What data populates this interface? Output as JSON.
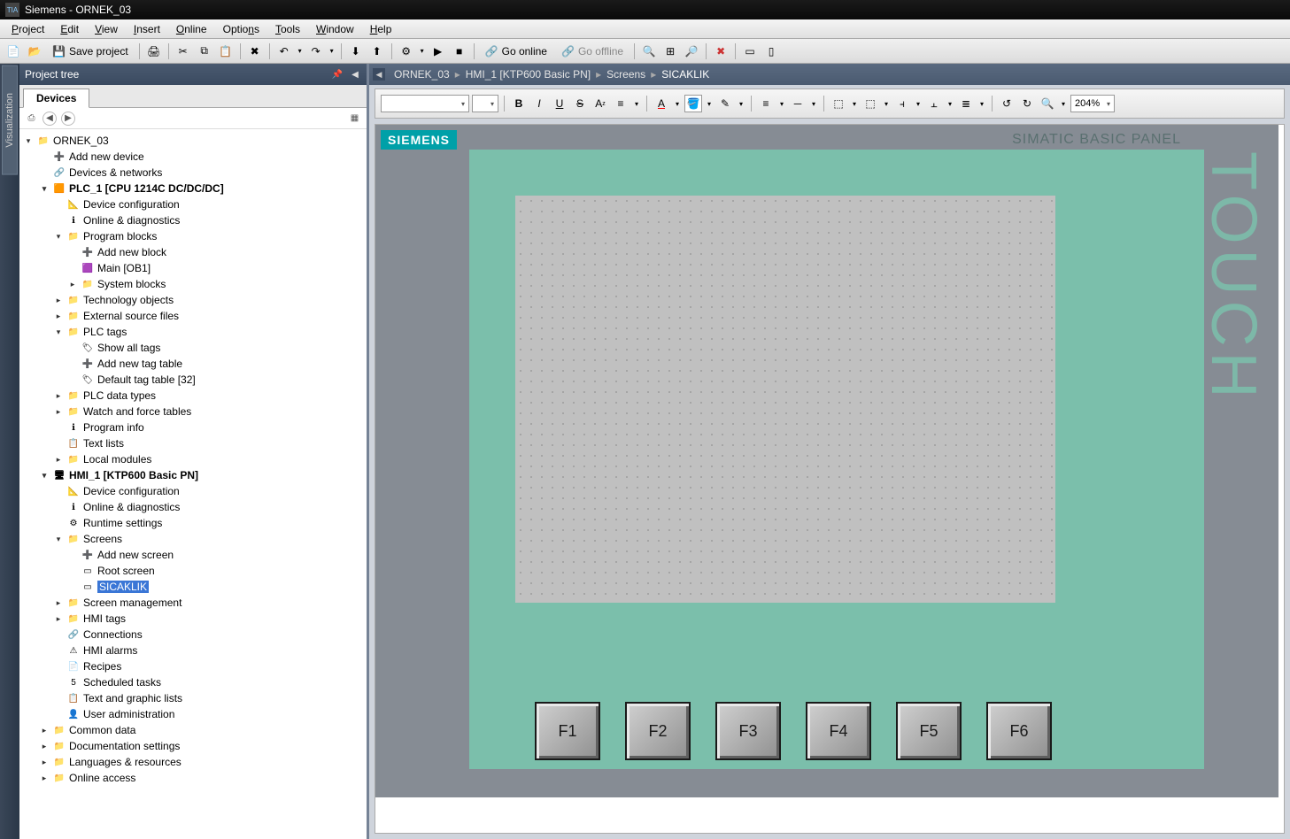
{
  "app": {
    "title": "Siemens  -  ORNEK_03"
  },
  "menu": [
    "Project",
    "Edit",
    "View",
    "Insert",
    "Online",
    "Options",
    "Tools",
    "Window",
    "Help"
  ],
  "toolbar": {
    "save_label": "Save project",
    "go_online": "Go online",
    "go_offline": "Go offline"
  },
  "sidebar_tab": "Visualization",
  "projtree": {
    "title": "Project tree"
  },
  "devices_tab": "Devices",
  "tree": {
    "root": "ORNEK_03",
    "add_device": "Add new device",
    "devices_networks": "Devices & networks",
    "plc": "PLC_1 [CPU 1214C DC/DC/DC]",
    "device_config": "Device configuration",
    "online_diag": "Online & diagnostics",
    "prog_blocks": "Program blocks",
    "add_block": "Add new block",
    "main_ob1": "Main [OB1]",
    "sys_blocks": "System blocks",
    "tech_obj": "Technology objects",
    "ext_src": "External source files",
    "plc_tags": "PLC tags",
    "show_all_tags": "Show all tags",
    "add_tag_table": "Add new tag table",
    "def_tag_table": "Default tag table [32]",
    "plc_data_types": "PLC data types",
    "watch_force": "Watch and force tables",
    "prog_info": "Program info",
    "text_lists": "Text lists",
    "local_modules": "Local modules",
    "hmi": "HMI_1 [KTP600 Basic PN]",
    "hmi_devcfg": "Device configuration",
    "hmi_online": "Online & diagnostics",
    "runtime": "Runtime settings",
    "screens": "Screens",
    "add_screen": "Add new screen",
    "root_screen": "Root screen",
    "sel_screen": "SICAKLIK",
    "screen_mgmt": "Screen management",
    "hmi_tags": "HMI tags",
    "connections": "Connections",
    "hmi_alarms": "HMI alarms",
    "recipes": "Recipes",
    "sched_tasks": "Scheduled tasks",
    "text_graphic": "Text and graphic lists",
    "user_admin": "User administration",
    "common_data": "Common data",
    "doc_settings": "Documentation settings",
    "lang_res": "Languages & resources",
    "online_access": "Online access"
  },
  "breadcrumb": [
    "ORNEK_03",
    "HMI_1 [KTP600 Basic PN]",
    "Screens",
    "SICAKLIK"
  ],
  "editor_toolbar": {
    "font_combo": "",
    "size_combo": "",
    "bold": "B",
    "italic": "I",
    "underline": "U",
    "strike": "S",
    "text_letter": "A",
    "zoom_value": "204%"
  },
  "hmi_panel": {
    "brand": "SIEMENS",
    "title": "SIMATIC BASIC PANEL",
    "side": "TOUCH",
    "fkeys": [
      "F1",
      "F2",
      "F3",
      "F4",
      "F5",
      "F6"
    ]
  }
}
